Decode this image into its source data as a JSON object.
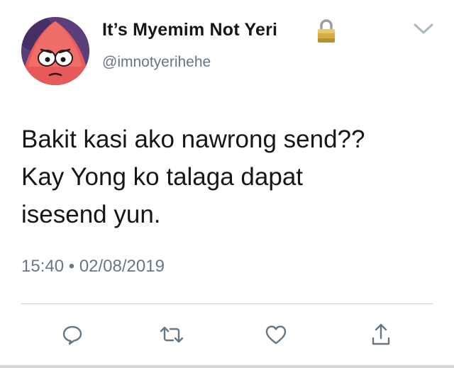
{
  "tweet": {
    "display_name": "It’s Myemim Not Yeri",
    "handle": "@imnotyerihehe",
    "text": "Bakit kasi ako nawrong send??\nKay Yong ko talaga dapat\nisesend yun.",
    "time": "15:40",
    "separator": "•",
    "date": "02/08/2019",
    "protected_icon": "lock-icon",
    "menu_icon": "chevron-down-icon"
  },
  "actions": [
    {
      "name": "reply",
      "icon": "speech-bubble-icon"
    },
    {
      "name": "retweet",
      "icon": "retweet-arrows-icon"
    },
    {
      "name": "like",
      "icon": "heart-icon"
    },
    {
      "name": "share",
      "icon": "share-arrow-up-icon"
    }
  ],
  "colors": {
    "text_primary": "#14171a",
    "text_secondary": "#657786",
    "icon_gray": "#657786",
    "divider": "#c8ced3",
    "lock_gold": "#c9a640"
  }
}
